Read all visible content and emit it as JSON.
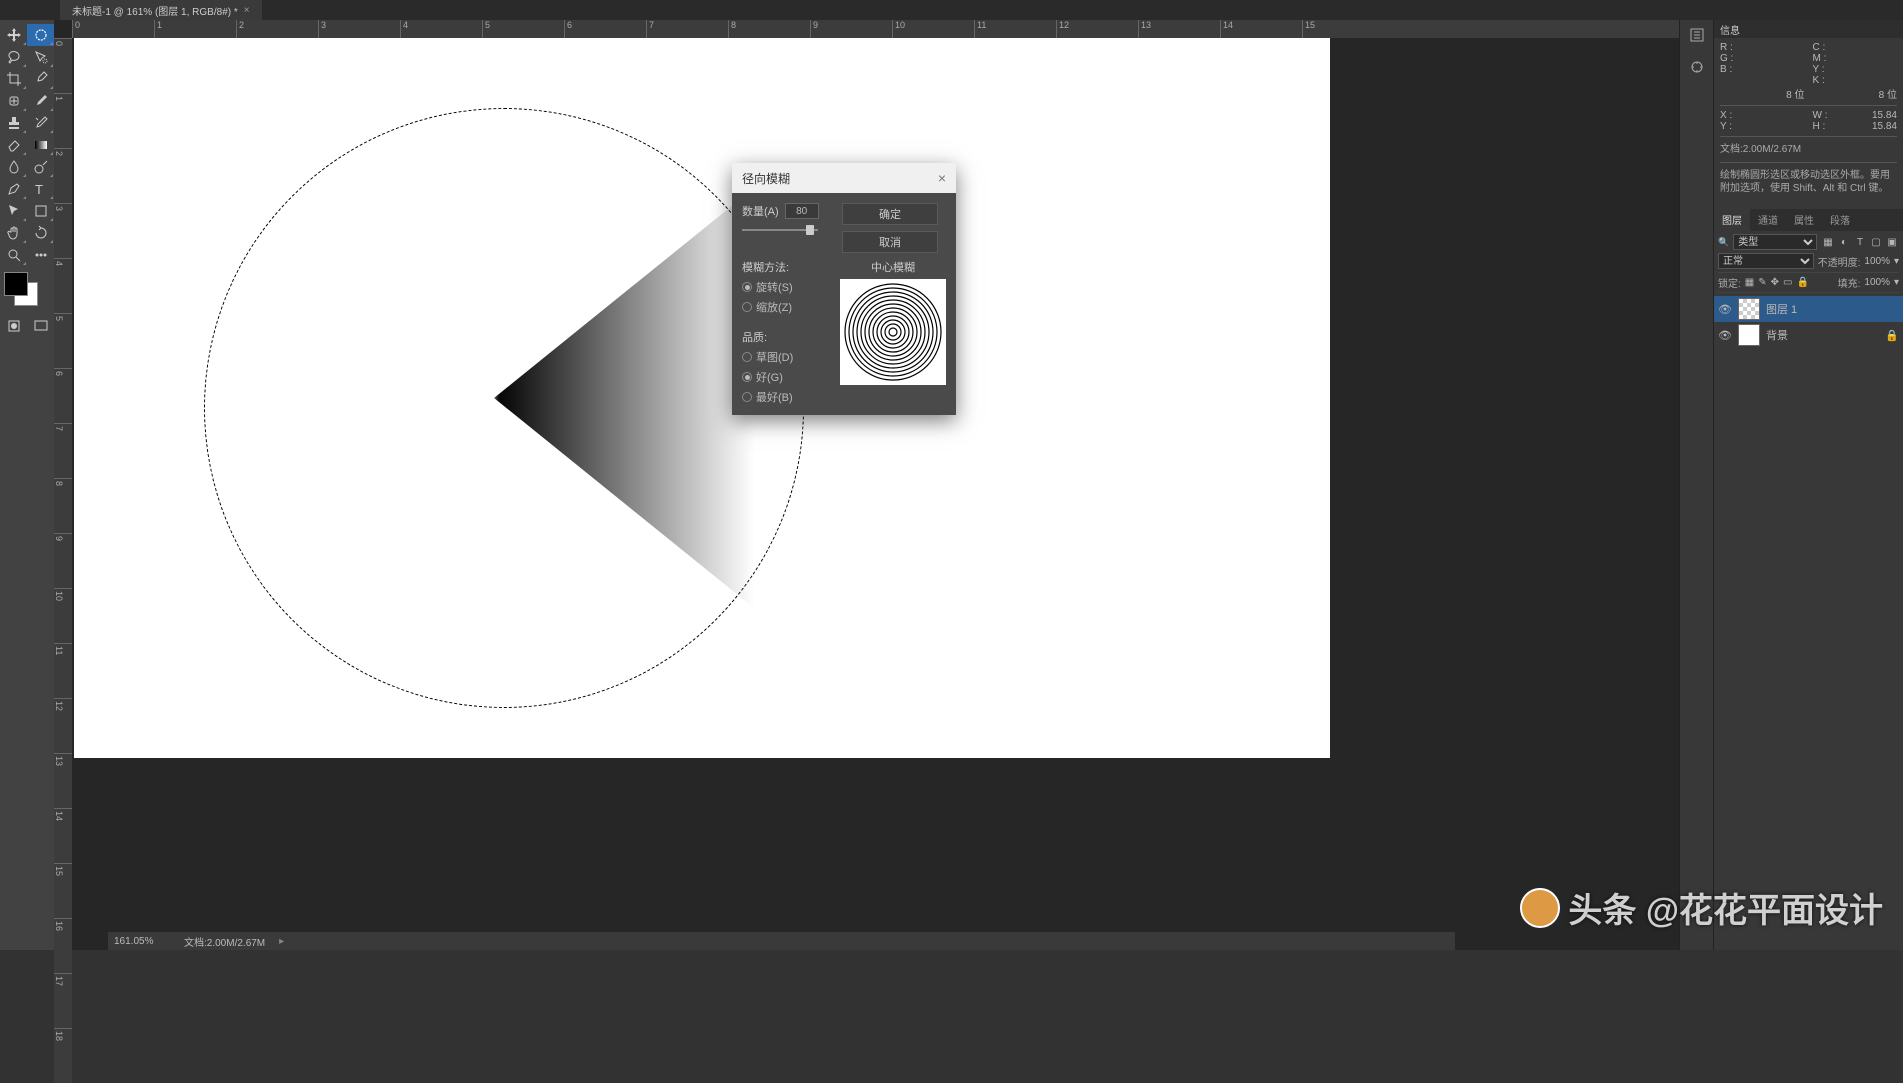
{
  "tab": {
    "title": "未标题-1 @ 161% (图层 1, RGB/8#) *"
  },
  "ruler_h": [
    0,
    1,
    2,
    3,
    4,
    5,
    6,
    7,
    8,
    9,
    10,
    11,
    12,
    13,
    14,
    15
  ],
  "ruler_v": [
    0,
    1,
    2,
    3,
    4,
    5,
    6,
    7,
    8,
    9,
    10,
    11,
    12,
    13,
    14,
    15,
    16,
    17,
    18
  ],
  "dialog": {
    "title": "径向模糊",
    "amount_label": "数量(A)",
    "amount_value": "80",
    "ok": "确定",
    "cancel": "取消",
    "method_label": "模糊方法:",
    "method_spin": "旋转(S)",
    "method_zoom": "缩放(Z)",
    "quality_label": "品质:",
    "quality_draft": "草图(D)",
    "quality_good": "好(G)",
    "quality_best": "最好(B)",
    "center_label": "中心模糊"
  },
  "info": {
    "title": "信息",
    "r": "R :",
    "g": "G :",
    "b": "B :",
    "c": "C :",
    "m": "M :",
    "y": "Y :",
    "k": "K :",
    "bit1": "8 位",
    "bit2": "8 位",
    "x": "X :",
    "yy": "Y :",
    "w": "W :",
    "h": "H :",
    "wv": "15.84",
    "hv": "15.84",
    "doc": "文档:2.00M/2.67M",
    "hint": "绘制椭圆形选区或移动选区外框。要用附加选项，使用 Shift、Alt 和 Ctrl 键。"
  },
  "layers_panel": {
    "tabs": [
      "图层",
      "通道",
      "属性",
      "段落"
    ],
    "type_label": "类型",
    "blend_mode": "正常",
    "opacity_label": "不透明度:",
    "opacity_value": "100%",
    "lock_label": "锁定:",
    "fill_label": "填充:",
    "fill_value": "100%",
    "layers": [
      {
        "name": "图层 1",
        "checker": true,
        "selected": true,
        "locked": false
      },
      {
        "name": "背景",
        "checker": false,
        "selected": false,
        "locked": true
      }
    ]
  },
  "status": {
    "zoom": "161.05%",
    "doc": "文档:2.00M/2.67M"
  },
  "watermark": "头条 @花花平面设计"
}
